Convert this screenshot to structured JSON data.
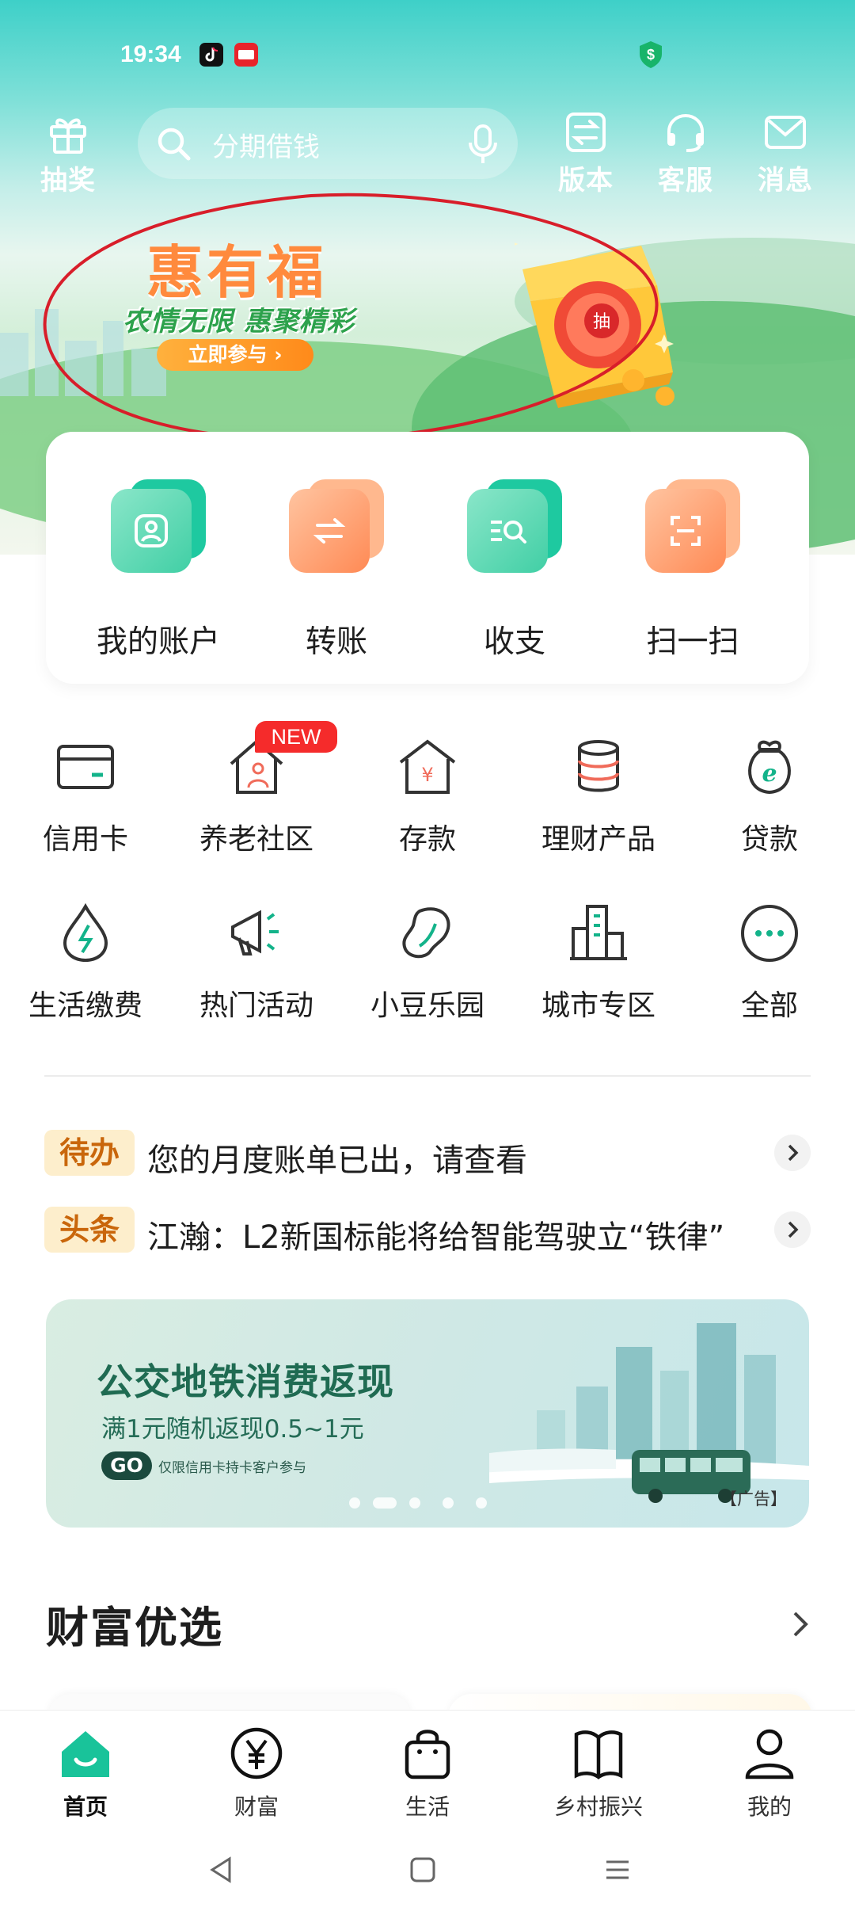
{
  "status": {
    "time": "19:34"
  },
  "header": {
    "lottery_label": "抽奖",
    "search_placeholder": "分期借钱",
    "version_label": "版本",
    "service_label": "客服",
    "message_label": "消息"
  },
  "banner": {
    "title": "惠有福",
    "subtitle": "农情无限 惠聚精彩",
    "button": "立即参与 ›",
    "gift_char": "抽"
  },
  "quick": [
    {
      "label": "我的账户",
      "icon": "account-icon"
    },
    {
      "label": "转账",
      "icon": "transfer-icon"
    },
    {
      "label": "收支",
      "icon": "income-expense-icon"
    },
    {
      "label": "扫一扫",
      "icon": "scan-icon"
    }
  ],
  "services": [
    {
      "label": "信用卡",
      "icon": "credit-card-icon"
    },
    {
      "label": "养老社区",
      "icon": "elderly-community-icon",
      "badge": "NEW"
    },
    {
      "label": "存款",
      "icon": "deposit-icon"
    },
    {
      "label": "理财产品",
      "icon": "wealth-product-icon"
    },
    {
      "label": "贷款",
      "icon": "loan-icon"
    },
    {
      "label": "生活缴费",
      "icon": "utility-payment-icon"
    },
    {
      "label": "热门活动",
      "icon": "megaphone-icon"
    },
    {
      "label": "小豆乐园",
      "icon": "bean-icon"
    },
    {
      "label": "城市专区",
      "icon": "city-icon"
    },
    {
      "label": "全部",
      "icon": "more-icon"
    }
  ],
  "news": [
    {
      "tag": "待办",
      "text": "您的月度账单已出，请查看"
    },
    {
      "tag": "头条",
      "text": "江瀚：L2新国标能将给智能驾驶立“铁律”"
    }
  ],
  "ad": {
    "title": "公交地铁消费返现",
    "subtitle": "满1元随机返现0.5~1元",
    "go": "GO",
    "note": "仅限信用卡持卡客户参与",
    "tag": "【广告】",
    "active_dot": 1,
    "dot_count": 5
  },
  "wealth": {
    "title": "财富优选"
  },
  "tabs": [
    {
      "label": "首页",
      "icon": "home-icon",
      "active": true
    },
    {
      "label": "财富",
      "icon": "yen-icon"
    },
    {
      "label": "生活",
      "icon": "shopping-bag-icon"
    },
    {
      "label": "乡村振兴",
      "icon": "book-icon"
    },
    {
      "label": "我的",
      "icon": "person-icon"
    }
  ],
  "colors": {
    "primary": "#16b38a",
    "hero_top": "#3ed0c8",
    "news_tag_bg": "#fdeecc",
    "news_tag_text": "#c9660b",
    "badge_red": "#f52b2b"
  }
}
